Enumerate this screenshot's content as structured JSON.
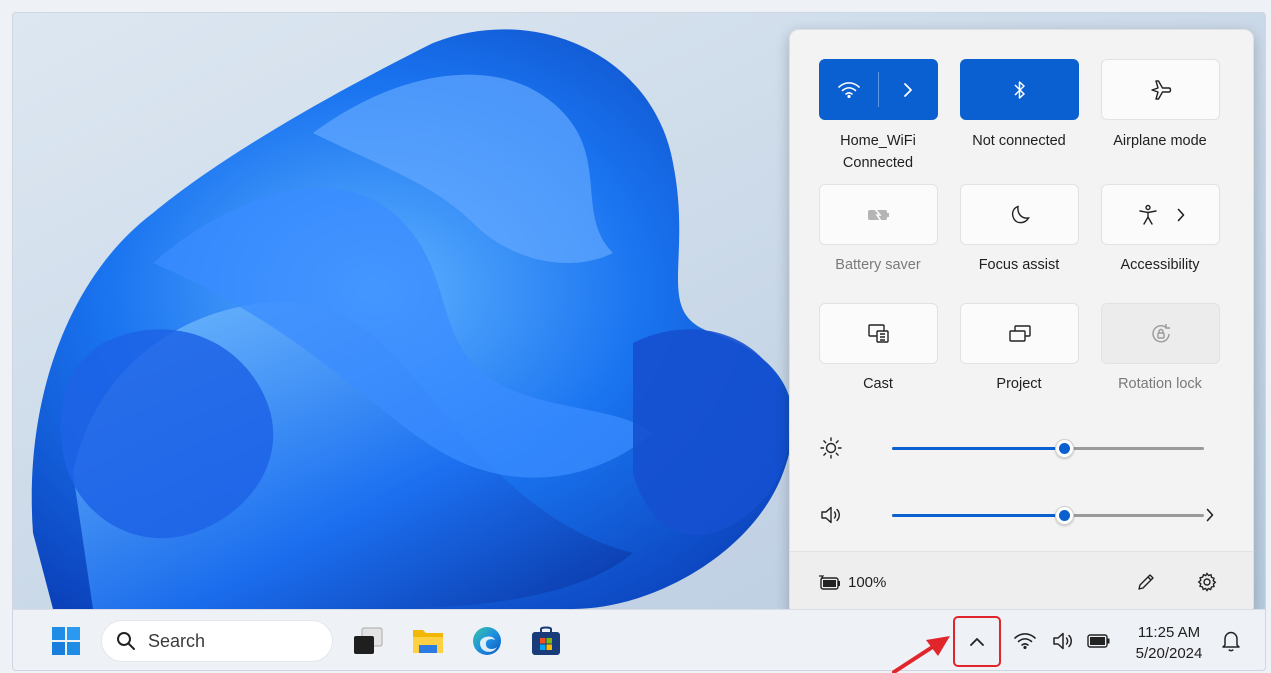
{
  "quick_settings": {
    "tiles": [
      {
        "id": "wifi",
        "label_line1": "Home_WiFi",
        "label_line2": "Connected",
        "icon": "wifi-icon",
        "state": "on"
      },
      {
        "id": "bluetooth",
        "label": "Not connected",
        "icon": "bluetooth-icon",
        "state": "on"
      },
      {
        "id": "airplane",
        "label": "Airplane mode",
        "icon": "airplane-icon",
        "state": "off"
      },
      {
        "id": "battery-saver",
        "label": "Battery saver",
        "icon": "battery-saver-icon",
        "state": "disabled"
      },
      {
        "id": "focus-assist",
        "label": "Focus assist",
        "icon": "moon-icon",
        "state": "off"
      },
      {
        "id": "accessibility",
        "label": "Accessibility",
        "icon": "accessibility-icon",
        "state": "off"
      },
      {
        "id": "cast",
        "label": "Cast",
        "icon": "cast-icon",
        "state": "off"
      },
      {
        "id": "project",
        "label": "Project",
        "icon": "project-icon",
        "state": "off"
      },
      {
        "id": "rotation-lock",
        "label": "Rotation lock",
        "icon": "rotation-lock-icon",
        "state": "disabled"
      }
    ],
    "brightness_level": 0.55,
    "volume_level": 0.55,
    "battery_percent": "100%"
  },
  "taskbar": {
    "search_placeholder": "Search",
    "time": "11:25 AM",
    "date": "5/20/2024"
  },
  "colors": {
    "accent": "#0a60d0",
    "highlight_border": "#e0262b",
    "arrow": "#e0262b"
  }
}
